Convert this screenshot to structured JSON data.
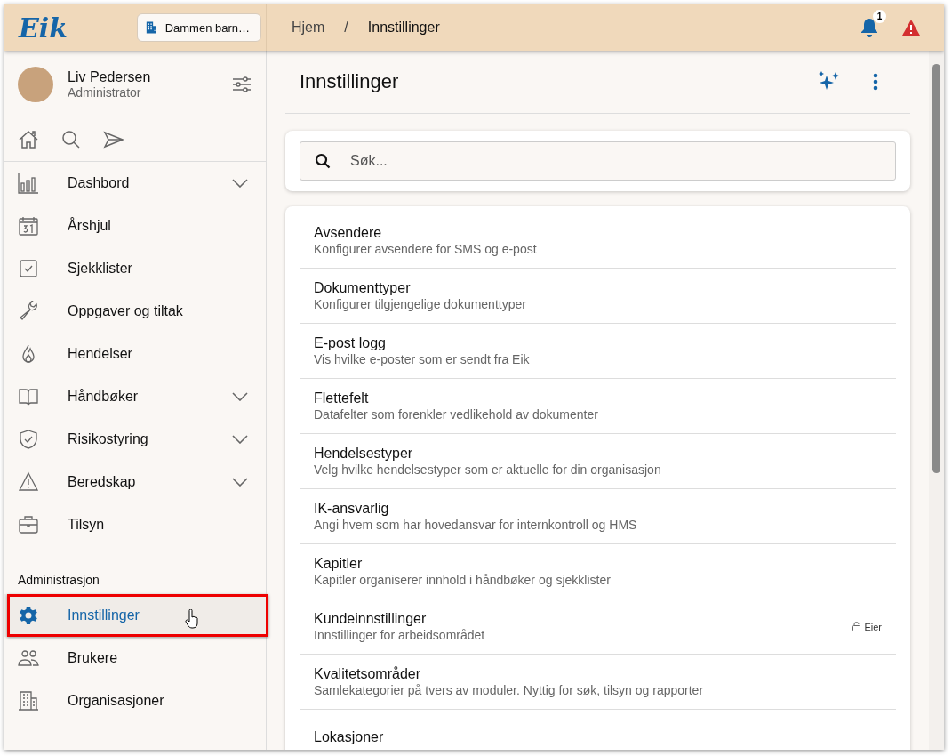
{
  "header": {
    "logo": "Eik",
    "org_button": "Dammen barn…",
    "breadcrumb": [
      {
        "label": "Hjem"
      },
      {
        "label": "Innstillinger"
      }
    ],
    "breadcrumb_separator": "/",
    "notification_count": "1"
  },
  "user": {
    "name": "Liv Pedersen",
    "role": "Administrator"
  },
  "nav": [
    {
      "label": "Dashbord",
      "expandable": true,
      "selected": false
    },
    {
      "label": "Årshjul",
      "expandable": false,
      "selected": false
    },
    {
      "label": "Sjekklister",
      "expandable": false,
      "selected": false
    },
    {
      "label": "Oppgaver og tiltak",
      "expandable": false,
      "selected": false
    },
    {
      "label": "Hendelser",
      "expandable": false,
      "selected": false
    },
    {
      "label": "Håndbøker",
      "expandable": true,
      "selected": false
    },
    {
      "label": "Risikostyring",
      "expandable": true,
      "selected": false
    },
    {
      "label": "Beredskap",
      "expandable": true,
      "selected": false
    },
    {
      "label": "Tilsyn",
      "expandable": false,
      "selected": false
    }
  ],
  "admin_section": {
    "heading": "Administrasjon",
    "items": [
      {
        "label": "Innstillinger",
        "selected": true,
        "highlighted": true
      },
      {
        "label": "Brukere",
        "selected": false,
        "highlighted": false
      },
      {
        "label": "Organisasjoner",
        "selected": false,
        "highlighted": false
      }
    ]
  },
  "page": {
    "title": "Innstillinger",
    "search": {
      "placeholder": "Søk..."
    },
    "settings": [
      {
        "title": "Avsendere",
        "description": "Konfigurer avsendere for SMS og e-post"
      },
      {
        "title": "Dokumenttyper",
        "description": "Konfigurer tilgjengelige dokumenttyper"
      },
      {
        "title": "E-post logg",
        "description": "Vis hvilke e-poster som er sendt fra Eik"
      },
      {
        "title": "Flettefelt",
        "description": "Datafelter som forenkler vedlikehold av dokumenter"
      },
      {
        "title": "Hendelsestyper",
        "description": "Velg hvilke hendelsestyper som er aktuelle for din organisasjon"
      },
      {
        "title": "IK-ansvarlig",
        "description": "Angi hvem som har hovedansvar for internkontroll og HMS"
      },
      {
        "title": "Kapitler",
        "description": "Kapitler organiserer innhold i håndbøker og sjekklister"
      },
      {
        "title": "Kundeinnstillinger",
        "description": "Innstillinger for arbeidsområdet",
        "badge": "Eier"
      },
      {
        "title": "Kvalitetsområder",
        "description": "Samlekategorier på tvers av moduler. Nyttig for søk, tilsyn og rapporter"
      },
      {
        "title": "Lokasjoner"
      }
    ]
  }
}
